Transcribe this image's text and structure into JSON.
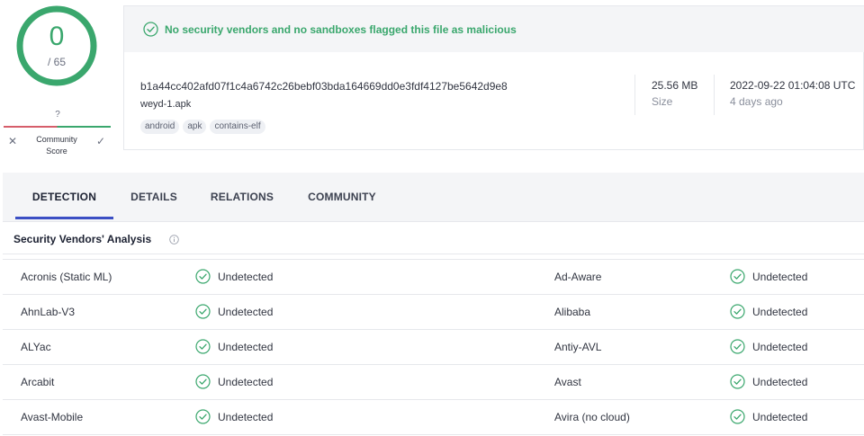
{
  "score": {
    "detections": "0",
    "total": "/ 65",
    "community_value": "?",
    "community_label": "Community\nScore",
    "ring_color": "#3aa76d"
  },
  "summary": {
    "banner": "No security vendors and no sandboxes flagged this file as malicious",
    "hash": "b1a44cc402afd07f1c4a6742c26bebf03bda164669dd0e3fdf4127be5642d9e8",
    "filename": "weyd-1.apk",
    "tags": [
      "android",
      "apk",
      "contains-elf"
    ],
    "size_value": "25.56 MB",
    "size_label": "Size",
    "date_value": "2022-09-22 01:04:08 UTC",
    "date_relative": "4 days ago"
  },
  "tabs": [
    {
      "label": "DETECTION"
    },
    {
      "label": "DETAILS"
    },
    {
      "label": "RELATIONS"
    },
    {
      "label": "COMMUNITY"
    }
  ],
  "section": {
    "title": "Security Vendors' Analysis"
  },
  "vendors": [
    {
      "left_name": "Acronis (Static ML)",
      "left_result": "Undetected",
      "right_name": "Ad-Aware",
      "right_result": "Undetected"
    },
    {
      "left_name": "AhnLab-V3",
      "left_result": "Undetected",
      "right_name": "Alibaba",
      "right_result": "Undetected"
    },
    {
      "left_name": "ALYac",
      "left_result": "Undetected",
      "right_name": "Antiy-AVL",
      "right_result": "Undetected"
    },
    {
      "left_name": "Arcabit",
      "left_result": "Undetected",
      "right_name": "Avast",
      "right_result": "Undetected"
    },
    {
      "left_name": "Avast-Mobile",
      "left_result": "Undetected",
      "right_name": "Avira (no cloud)",
      "right_result": "Undetected"
    }
  ],
  "colors": {
    "clean": "#3aa76d",
    "malicious": "#d65e6b",
    "accent": "#3b4fc4"
  },
  "icons": {
    "check": "check-circle-icon",
    "info": "info-icon",
    "vote_down": "close-icon",
    "vote_up": "check-icon"
  }
}
